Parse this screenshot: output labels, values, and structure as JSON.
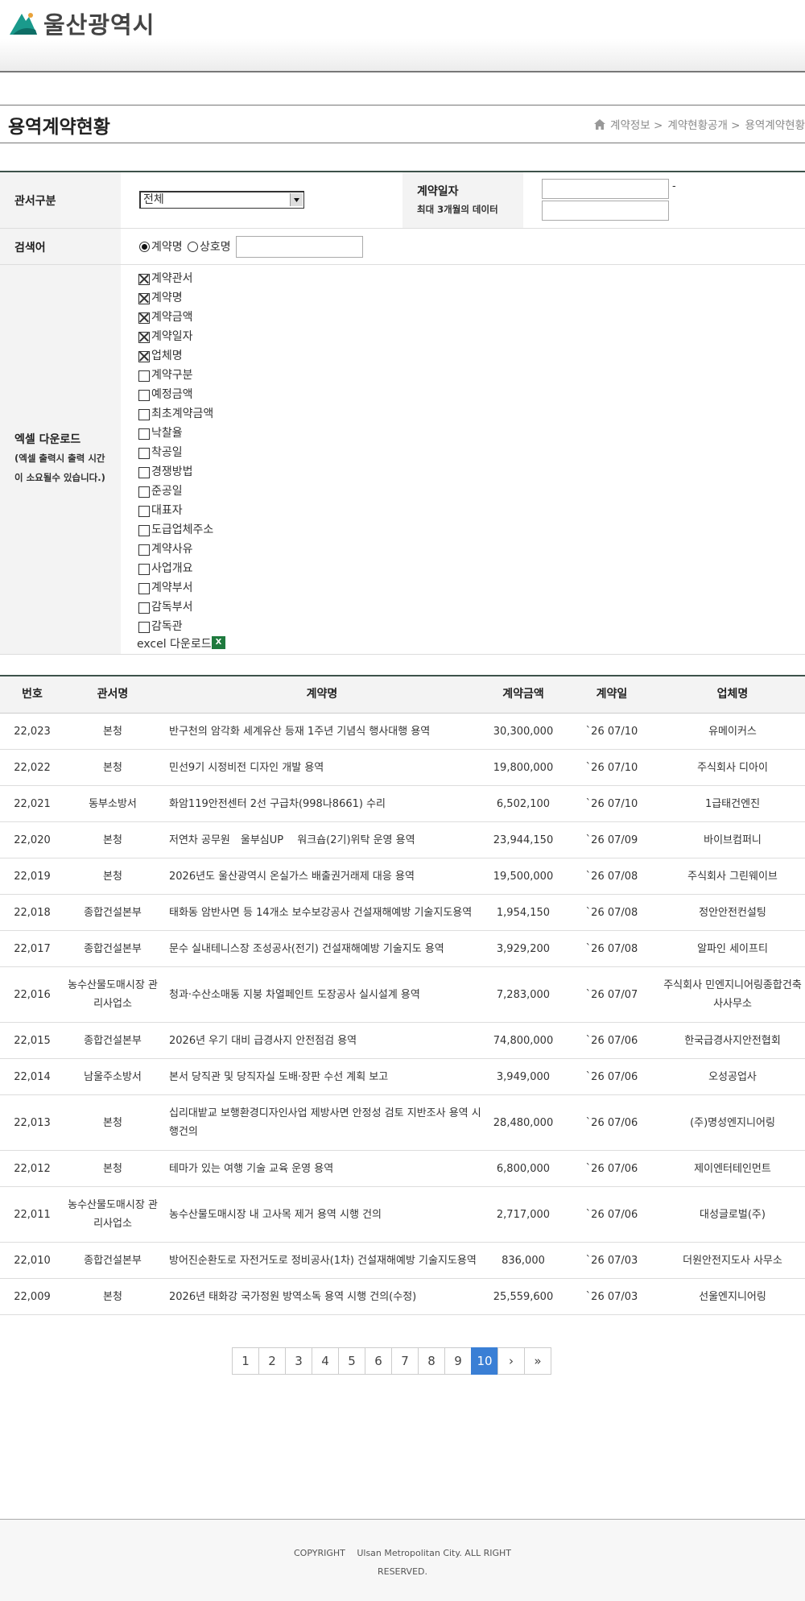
{
  "header": {
    "logo_text": "울산광역시"
  },
  "page": {
    "title": "용역계약현황"
  },
  "breadcrumb": {
    "items": [
      "계약정보 >",
      "계약현황공개 >",
      "용역계약현황"
    ]
  },
  "form": {
    "dept_label": "관서구분",
    "dept_selected": "전체",
    "date_label": "계약일자",
    "date_sublabel": "최대 3개월의 데이터",
    "date_separator": "-",
    "search_label": "검색어",
    "search_options": [
      "계약명",
      "상호명"
    ],
    "search_selected": "계약명",
    "search_value": "",
    "excel_label": "엑셀 다운로드",
    "excel_note_1": "(엑셀 출력시 출력 시간",
    "excel_note_2": "이 소요될수 있습니다.)",
    "excel_columns": [
      {
        "label": "계약관서",
        "checked": true
      },
      {
        "label": "계약명",
        "checked": true
      },
      {
        "label": "계약금액",
        "checked": true
      },
      {
        "label": "계약일자",
        "checked": true
      },
      {
        "label": "업체명",
        "checked": true
      },
      {
        "label": "계약구분",
        "checked": false
      },
      {
        "label": "예정금액",
        "checked": false
      },
      {
        "label": "최초계약금액",
        "checked": false
      },
      {
        "label": "낙찰율",
        "checked": false
      },
      {
        "label": "착공일",
        "checked": false
      },
      {
        "label": "경쟁방법",
        "checked": false
      },
      {
        "label": "준공일",
        "checked": false
      },
      {
        "label": "대표자",
        "checked": false
      },
      {
        "label": "도급업체주소",
        "checked": false
      },
      {
        "label": "계약사유",
        "checked": false
      },
      {
        "label": "사업개요",
        "checked": false
      },
      {
        "label": "계약부서",
        "checked": false
      },
      {
        "label": "감독부서",
        "checked": false
      },
      {
        "label": "감독관",
        "checked": false
      }
    ],
    "excel_download_text": "excel 다운로드",
    "excel_icon_label": "X"
  },
  "table": {
    "headers": [
      "번호",
      "관서명",
      "계약명",
      "계약금액",
      "계약일",
      "업체명"
    ],
    "rows": [
      {
        "no": "22,023",
        "dept": "본청",
        "title": "반구천의 암각화 세계유산 등재 1주년 기념식 행사대행 용역",
        "amount": "30,300,000",
        "date": "`26 07/10",
        "company": "유메이커스"
      },
      {
        "no": "22,022",
        "dept": "본청",
        "title": "민선9기 시정비전 디자인 개발 용역",
        "amount": "19,800,000",
        "date": "`26 07/10",
        "company": "주식회사 디아이"
      },
      {
        "no": "22,021",
        "dept": "동부소방서",
        "title": "화암119안전센터 2선 구급차(998나8661) 수리",
        "amount": "6,502,100",
        "date": "`26 07/10",
        "company": "1급태건엔진"
      },
      {
        "no": "22,020",
        "dept": "본청",
        "title": "저연차 공무원　울부심UP　 워크숍(2기)위탁 운영 용역",
        "amount": "23,944,150",
        "date": "`26 07/09",
        "company": "바이브컴퍼니"
      },
      {
        "no": "22,019",
        "dept": "본청",
        "title": "2026년도 울산광역시 온실가스 배출권거래제 대응 용역",
        "amount": "19,500,000",
        "date": "`26 07/08",
        "company": "주식회사 그린웨이브"
      },
      {
        "no": "22,018",
        "dept": "종합건설본부",
        "title": "태화동 암반사면 등 14개소 보수보강공사 건설재해예방 기술지도용역",
        "amount": "1,954,150",
        "date": "`26 07/08",
        "company": "정안안전컨설팅"
      },
      {
        "no": "22,017",
        "dept": "종합건설본부",
        "title": "문수 실내테니스장 조성공사(전기) 건설재해예방 기술지도 용역",
        "amount": "3,929,200",
        "date": "`26 07/08",
        "company": "알파인 세이프티"
      },
      {
        "no": "22,016",
        "dept": "농수산물도매시장 관리사업소",
        "title": "청과·수산소매동 지붕 차열페인트 도장공사 실시설계 용역",
        "amount": "7,283,000",
        "date": "`26 07/07",
        "company": "주식회사 민엔지니어링종합건축사사무소"
      },
      {
        "no": "22,015",
        "dept": "종합건설본부",
        "title": "2026년 우기 대비 급경사지 안전점검 용역",
        "amount": "74,800,000",
        "date": "`26 07/06",
        "company": "한국급경사지안전협회"
      },
      {
        "no": "22,014",
        "dept": "남울주소방서",
        "title": "본서 당직관 및 당직자실 도배·장판 수선 계획 보고",
        "amount": "3,949,000",
        "date": "`26 07/06",
        "company": "오성공업사"
      },
      {
        "no": "22,013",
        "dept": "본청",
        "title": "십리대밭교 보행환경디자인사업 제방사면 안정성 검토 지반조사 용역 시행건의",
        "amount": "28,480,000",
        "date": "`26 07/06",
        "company": "(주)명성엔지니어링"
      },
      {
        "no": "22,012",
        "dept": "본청",
        "title": "테마가 있는 여행 기술 교육 운영 용역",
        "amount": "6,800,000",
        "date": "`26 07/06",
        "company": "제이엔터테인먼트"
      },
      {
        "no": "22,011",
        "dept": "농수산물도매시장 관리사업소",
        "title": "농수산물도매시장 내 고사목 제거 용역 시행 건의",
        "amount": "2,717,000",
        "date": "`26 07/06",
        "company": "대성글로벌(주)"
      },
      {
        "no": "22,010",
        "dept": "종합건설본부",
        "title": "방어진순환도로 자전거도로 정비공사(1차) 건설재해예방 기술지도용역",
        "amount": "836,000",
        "date": "`26 07/03",
        "company": "더원안전지도사 사무소"
      },
      {
        "no": "22,009",
        "dept": "본청",
        "title": "2026년 태화강 국가정원 방역소독 용역 시행 건의(수정)",
        "amount": "25,559,600",
        "date": "`26 07/03",
        "company": "선울엔지니어링"
      }
    ]
  },
  "pagination": {
    "pages": [
      "1",
      "2",
      "3",
      "4",
      "5",
      "6",
      "7",
      "8",
      "9",
      "10"
    ],
    "current": "10",
    "next": "›",
    "last": "»"
  },
  "footer": {
    "copyright_1": "COPYRIGHT　 Ulsan Metropolitan City. ALL RIGHT",
    "copyright_2": "RESERVED."
  },
  "colors": {
    "accent": "#3a7fd5",
    "logo_teal": "#1a9a8c",
    "border_dark": "#3d524a"
  }
}
